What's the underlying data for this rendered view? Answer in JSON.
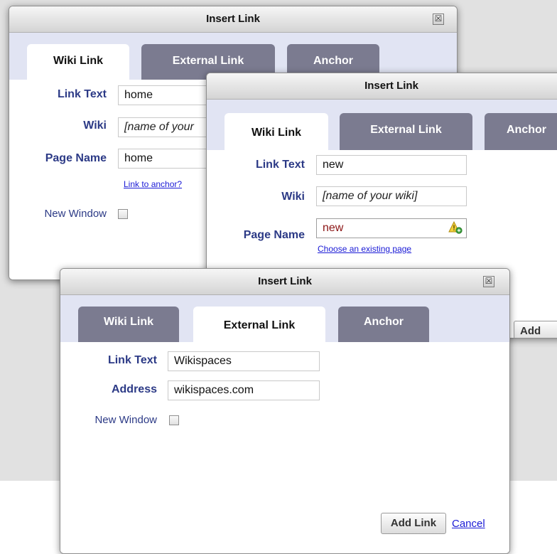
{
  "dialogs": {
    "back": {
      "title": "Insert Link",
      "close_glyph": "☒",
      "tabs": [
        "Wiki Link",
        "External Link",
        "Anchor"
      ],
      "fields": {
        "link_text_label": "Link Text",
        "link_text_value": "home",
        "wiki_label": "Wiki",
        "wiki_placeholder": "[name of your",
        "page_name_label": "Page Name",
        "page_name_value": "home",
        "anchor_link": "Link to anchor?",
        "new_window_label": "New Window"
      }
    },
    "middle": {
      "title": "Insert Link",
      "tabs": [
        "Wiki Link",
        "External Link",
        "Anchor"
      ],
      "fields": {
        "link_text_label": "Link Text",
        "link_text_value": "new",
        "wiki_label": "Wiki",
        "wiki_placeholder": "[name of your wiki]",
        "page_name_label": "Page Name",
        "page_name_value": "new",
        "choose_existing_link": "Choose an existing page",
        "add_button_partial": "Add"
      },
      "warning_icon": "warning-add-icon"
    },
    "front": {
      "title": "Insert Link",
      "close_glyph": "☒",
      "tabs": [
        "Wiki Link",
        "External Link",
        "Anchor"
      ],
      "fields": {
        "link_text_label": "Link Text",
        "link_text_value": "Wikispaces",
        "address_label": "Address",
        "address_value": "wikispaces.com",
        "new_window_label": "New Window"
      },
      "add_link_button": "Add Link",
      "cancel_link": "Cancel"
    }
  },
  "colors": {
    "label_blue": "#2c3a86",
    "tab_strip": "#e1e4f3",
    "inactive_tab": "#7b7b90",
    "error_text": "#8b1414",
    "link_blue": "#1a1ad6"
  }
}
